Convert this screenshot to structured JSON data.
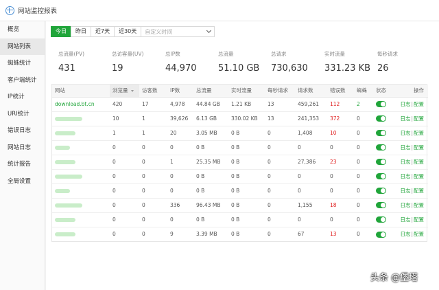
{
  "window": {
    "title": "网站监控报表"
  },
  "sidebar": {
    "items": [
      {
        "label": "概览"
      },
      {
        "label": "网站列表"
      },
      {
        "label": "蜘蛛统计"
      },
      {
        "label": "客户端统计"
      },
      {
        "label": "IP统计"
      },
      {
        "label": "URI统计"
      },
      {
        "label": "错误日志"
      },
      {
        "label": "网站日志"
      },
      {
        "label": "统计报告"
      },
      {
        "label": "全局设置"
      }
    ]
  },
  "datebar": {
    "buttons": [
      "今日",
      "昨日",
      "近7天",
      "近30天"
    ],
    "custom_placeholder": "自定义时间"
  },
  "stats": [
    {
      "label": "总流量(PV)",
      "value": "431"
    },
    {
      "label": "总访客量(UV)",
      "value": "19"
    },
    {
      "label": "总IP数",
      "value": "44,970"
    },
    {
      "label": "总流量",
      "value": "51.10 GB"
    },
    {
      "label": "总请求",
      "value": "730,630"
    },
    {
      "label": "实时流量",
      "value": "331.23 KB"
    },
    {
      "label": "每秒请求",
      "value": "26"
    }
  ],
  "table": {
    "headers": [
      "网站",
      "浏览量",
      "访客数",
      "IP数",
      "总流量",
      "实时流量",
      "每秒请求",
      "请求数",
      "错误数",
      "蜘蛛",
      "状态",
      "操作"
    ],
    "op_log": "日志",
    "op_sep": "|",
    "op_config": "配置",
    "rows": [
      {
        "site": "download.bt.cn",
        "pv": "420",
        "uv": "17",
        "ip": "4,978",
        "traffic": "44.84 GB",
        "realtime": "1.21 KB",
        "qps": "13",
        "requests": "459,261",
        "errors": "112",
        "spider": "2"
      },
      {
        "site": "",
        "pv": "10",
        "uv": "1",
        "ip": "39,626",
        "traffic": "6.13 GB",
        "realtime": "330.02 KB",
        "qps": "13",
        "requests": "241,353",
        "errors": "372",
        "spider": "0"
      },
      {
        "site": "",
        "pv": "1",
        "uv": "1",
        "ip": "20",
        "traffic": "3.05 MB",
        "realtime": "0 B",
        "qps": "0",
        "requests": "1,408",
        "errors": "10",
        "spider": "0"
      },
      {
        "site": "",
        "pv": "0",
        "uv": "0",
        "ip": "0",
        "traffic": "0 B",
        "realtime": "0 B",
        "qps": "0",
        "requests": "0",
        "errors": "0",
        "spider": "0"
      },
      {
        "site": "",
        "pv": "0",
        "uv": "0",
        "ip": "1",
        "traffic": "25.35 MB",
        "realtime": "0 B",
        "qps": "0",
        "requests": "27,386",
        "errors": "23",
        "spider": "0"
      },
      {
        "site": "",
        "pv": "0",
        "uv": "0",
        "ip": "0",
        "traffic": "0 B",
        "realtime": "0 B",
        "qps": "0",
        "requests": "0",
        "errors": "0",
        "spider": "0"
      },
      {
        "site": "",
        "pv": "0",
        "uv": "0",
        "ip": "0",
        "traffic": "0 B",
        "realtime": "0 B",
        "qps": "0",
        "requests": "0",
        "errors": "0",
        "spider": "0"
      },
      {
        "site": "",
        "pv": "0",
        "uv": "0",
        "ip": "336",
        "traffic": "96.43 MB",
        "realtime": "0 B",
        "qps": "0",
        "requests": "1,155",
        "errors": "18",
        "spider": "0"
      },
      {
        "site": "",
        "pv": "0",
        "uv": "0",
        "ip": "0",
        "traffic": "0 B",
        "realtime": "0 B",
        "qps": "0",
        "requests": "0",
        "errors": "0",
        "spider": "0"
      },
      {
        "site": "",
        "pv": "0",
        "uv": "0",
        "ip": "9",
        "traffic": "3.39 MB",
        "realtime": "0 B",
        "qps": "0",
        "requests": "67",
        "errors": "13",
        "spider": "0"
      }
    ]
  },
  "watermark": "头条 @堡塔",
  "colors": {
    "accent": "#20a53a",
    "error": "#e02020"
  }
}
